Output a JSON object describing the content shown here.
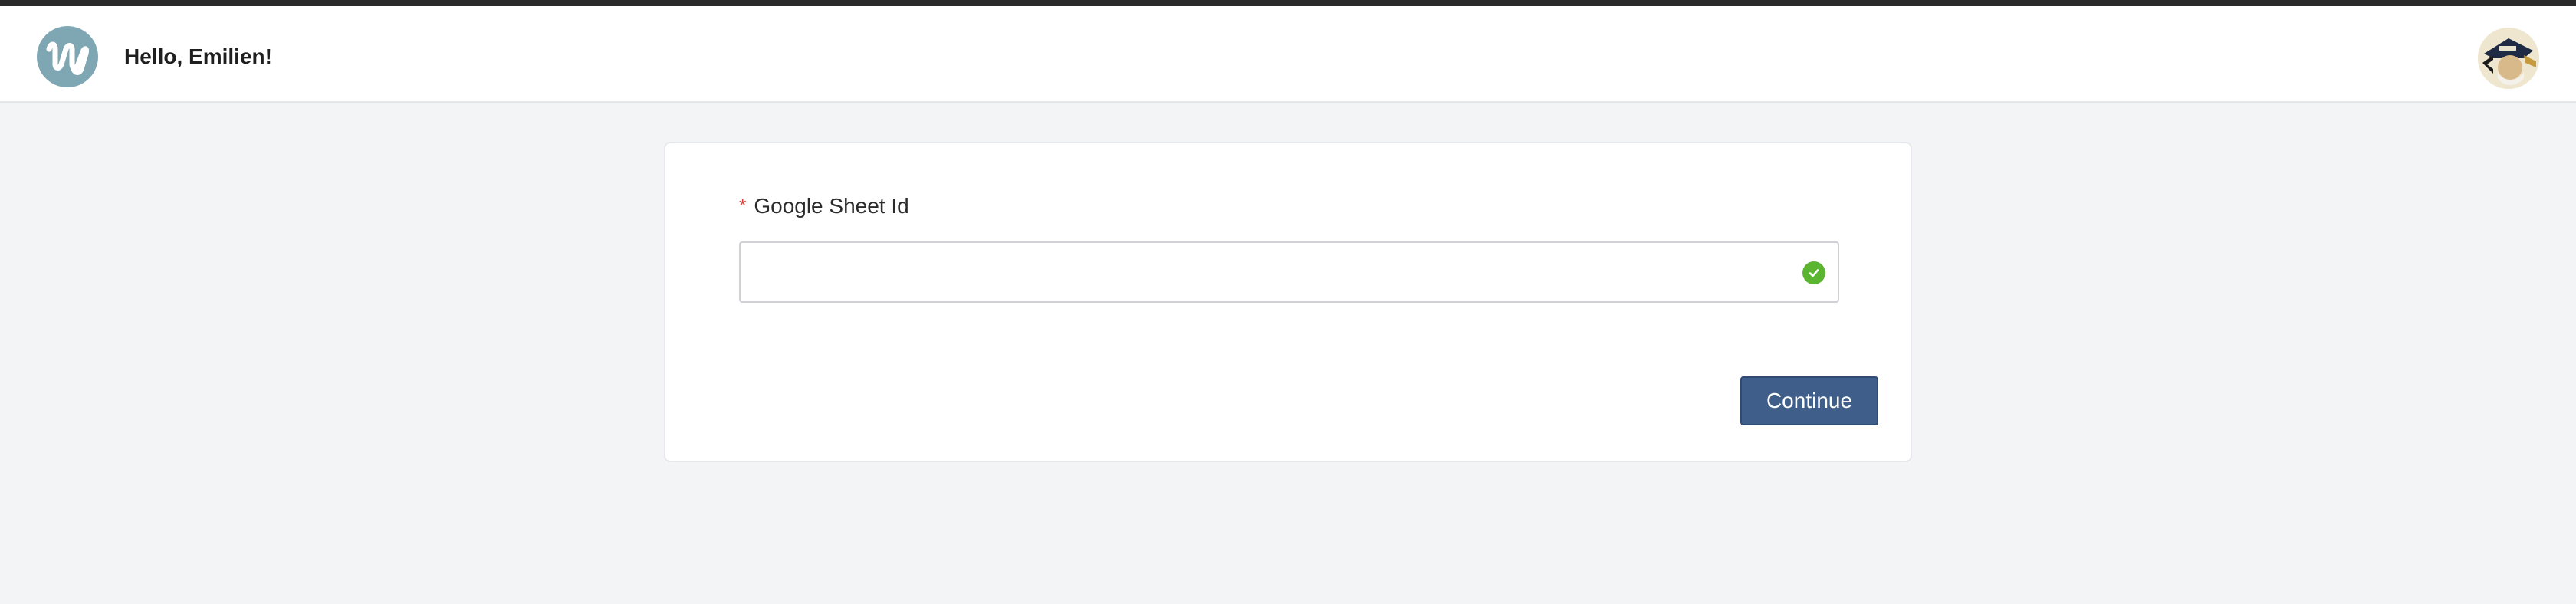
{
  "header": {
    "greeting": "Hello, Emilien!",
    "logo_icon": "brand-logo-w",
    "avatar_icon": "user-avatar"
  },
  "form": {
    "field": {
      "required_mark": "*",
      "label": "Google Sheet Id",
      "value": "",
      "placeholder": "",
      "status_icon": "check-circle-icon",
      "status_color": "#5cb531"
    },
    "continue_label": "Continue"
  },
  "colors": {
    "accent_bar": "#2a2a2a",
    "logo_bg": "#7ea6b3",
    "button_bg": "#3f5f8a",
    "required": "#e53935",
    "page_bg": "#f3f4f6"
  }
}
